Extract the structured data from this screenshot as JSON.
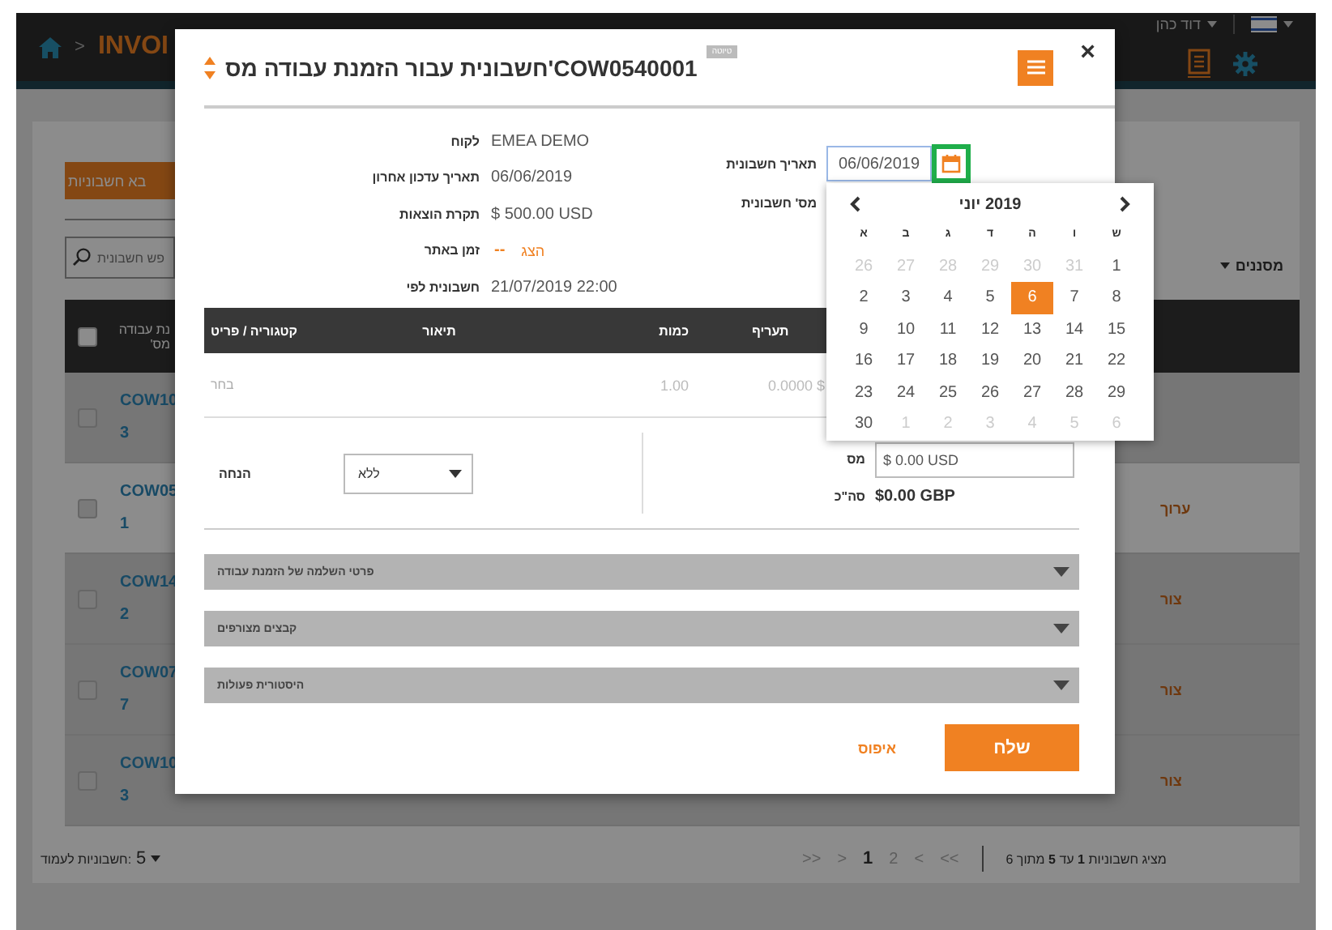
{
  "header": {
    "separator": ">",
    "title": "INVOI",
    "user": "דוד כהן"
  },
  "page": {
    "import_button": "בא חשבוניות",
    "search": {
      "placeholder": "פש חשבונית"
    },
    "filters": "מסננים",
    "table": {
      "header": [
        "נת עבודה",
        "מס'"
      ],
      "header_checked": false,
      "rows": [
        {
          "id": "COW10",
          "line2": "3",
          "checked": false,
          "highlighted": false
        },
        {
          "id": "COW05",
          "line2": "1",
          "checked": false,
          "highlighted": true,
          "action": "ערוך"
        },
        {
          "id": "COW14",
          "line2": "2",
          "checked": false,
          "highlighted": false,
          "action": "צור"
        },
        {
          "id": "COW07",
          "line2": "7",
          "checked": false,
          "highlighted": false,
          "action": "צור"
        },
        {
          "id": "COW10",
          "line2": "3",
          "checked": false,
          "highlighted": false,
          "action": "צור"
        }
      ]
    },
    "footer": {
      "per_page_label": "חשבוניות לעמוד:",
      "per_page": "5",
      "summary": "מציג חשבוניות **1** עד **5** מתוך 6",
      "pager": [
        {
          "label": ">>",
          "selected": false
        },
        {
          "label": ">",
          "selected": false
        },
        {
          "label": "2",
          "selected": false
        },
        {
          "label": "1",
          "selected": true
        },
        {
          "label": "<",
          "selected": false
        },
        {
          "label": "<<",
          "selected": false
        }
      ]
    }
  },
  "modal": {
    "title": "COW0540001'חשבונית עבור הזמנת עבודה מס",
    "badge": "טיוטה",
    "close": "×",
    "fields": [
      {
        "kind": "text",
        "label": "לקוח",
        "value": "EMEA DEMO"
      },
      {
        "kind": "text",
        "label": "תאריך עדכון אחרון",
        "value": "06/06/2019"
      },
      {
        "kind": "text",
        "label": "תקרת הוצאות",
        "value": "$ 500.00 USD"
      },
      {
        "kind": "link",
        "label": "זמן באתר",
        "value": "--",
        "link": "הצג"
      },
      {
        "kind": "text",
        "label": "חשבונית לפי",
        "value": "21/07/2019 22:00"
      }
    ],
    "invoice_date": {
      "label": "תאריך חשבונית",
      "value": "06/06/2019"
    },
    "invoice_number": {
      "label": "מס' חשבונית"
    },
    "lines": {
      "columns": [
        "תעריף",
        "כמות",
        "תיאור",
        "קטגוריה / פריט"
      ],
      "row": {
        "item": "בחר",
        "quantity": "1.00",
        "rate": "$ 0.0000"
      }
    },
    "discount": {
      "label": "הנחה",
      "value": "ללא"
    },
    "tax": {
      "label": "מס",
      "value": "$ 0.00 USD"
    },
    "total": {
      "label": "סה\"כ",
      "value": "$0.00 GBP"
    },
    "sections": [
      "פרטי השלמה של הזמנת עבודה",
      "קבצים מצורפים",
      "היסטורית פעולות"
    ],
    "reset": "איפוס",
    "send": "שלח"
  },
  "calendar": {
    "month": "2019 יוני",
    "weekdays": [
      "ש",
      "ו",
      "ה",
      "ד",
      "ג",
      "ב",
      "א"
    ],
    "days": [
      {
        "label": "1",
        "muted": false,
        "selected": false
      },
      {
        "label": "31",
        "muted": true,
        "selected": false
      },
      {
        "label": "30",
        "muted": true,
        "selected": false
      },
      {
        "label": "29",
        "muted": true,
        "selected": false
      },
      {
        "label": "28",
        "muted": true,
        "selected": false
      },
      {
        "label": "27",
        "muted": true,
        "selected": false
      },
      {
        "label": "26",
        "muted": true,
        "selected": false
      },
      {
        "label": "8",
        "muted": false,
        "selected": false
      },
      {
        "label": "7",
        "muted": false,
        "selected": false
      },
      {
        "label": "6",
        "muted": false,
        "selected": true
      },
      {
        "label": "5",
        "muted": false,
        "selected": false
      },
      {
        "label": "4",
        "muted": false,
        "selected": false
      },
      {
        "label": "3",
        "muted": false,
        "selected": false
      },
      {
        "label": "2",
        "muted": false,
        "selected": false
      },
      {
        "label": "15",
        "muted": false,
        "selected": false
      },
      {
        "label": "14",
        "muted": false,
        "selected": false
      },
      {
        "label": "13",
        "muted": false,
        "selected": false
      },
      {
        "label": "12",
        "muted": false,
        "selected": false
      },
      {
        "label": "11",
        "muted": false,
        "selected": false
      },
      {
        "label": "10",
        "muted": false,
        "selected": false
      },
      {
        "label": "9",
        "muted": false,
        "selected": false
      },
      {
        "label": "22",
        "muted": false,
        "selected": false
      },
      {
        "label": "21",
        "muted": false,
        "selected": false
      },
      {
        "label": "20",
        "muted": false,
        "selected": false
      },
      {
        "label": "19",
        "muted": false,
        "selected": false
      },
      {
        "label": "18",
        "muted": false,
        "selected": false
      },
      {
        "label": "17",
        "muted": false,
        "selected": false
      },
      {
        "label": "16",
        "muted": false,
        "selected": false
      },
      {
        "label": "29",
        "muted": false,
        "selected": false
      },
      {
        "label": "28",
        "muted": false,
        "selected": false
      },
      {
        "label": "27",
        "muted": false,
        "selected": false
      },
      {
        "label": "26",
        "muted": false,
        "selected": false
      },
      {
        "label": "25",
        "muted": false,
        "selected": false
      },
      {
        "label": "24",
        "muted": false,
        "selected": false
      },
      {
        "label": "23",
        "muted": false,
        "selected": false
      },
      {
        "label": "6",
        "muted": true,
        "selected": false
      },
      {
        "label": "5",
        "muted": true,
        "selected": false
      },
      {
        "label": "4",
        "muted": true,
        "selected": false
      },
      {
        "label": "3",
        "muted": true,
        "selected": false
      },
      {
        "label": "2",
        "muted": true,
        "selected": false
      },
      {
        "label": "1",
        "muted": true,
        "selected": false
      },
      {
        "label": "30",
        "muted": false,
        "selected": false
      }
    ]
  }
}
